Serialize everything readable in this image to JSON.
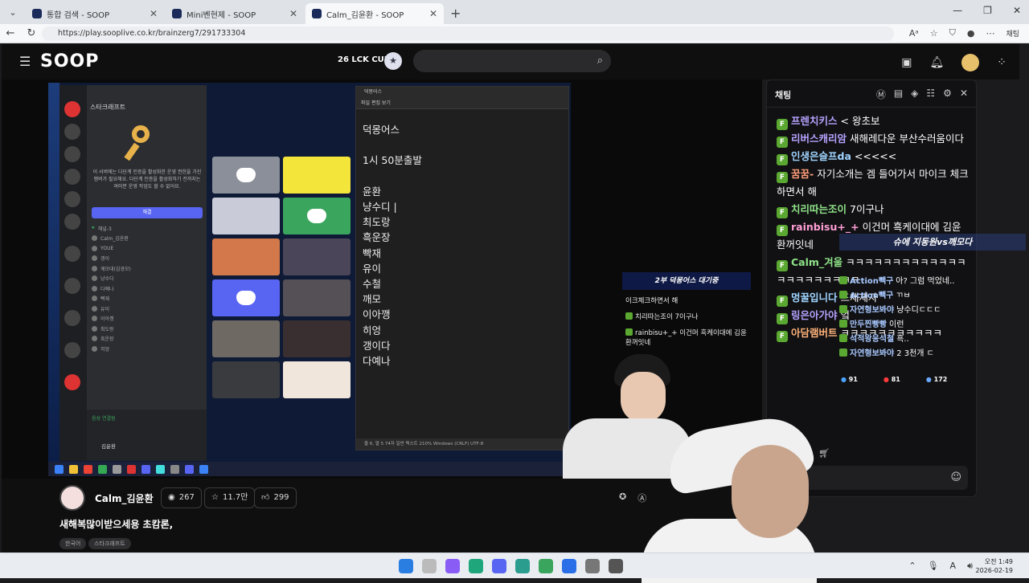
{
  "browser": {
    "tabs": [
      {
        "label": "통합 검색 - SOOP",
        "active": false
      },
      {
        "label": "Mini벤현제 - SOOP",
        "active": false
      },
      {
        "label": "Calm_김윤환 - SOOP",
        "active": true
      }
    ],
    "url": "https://play.sooplive.co.kr/brainzerg7/291733304",
    "chat_button": "채팅"
  },
  "header": {
    "logo": "SOOP",
    "event": "26 LCK CUP"
  },
  "stream": {
    "discord": {
      "server": "스타크래프트",
      "window_title": "스타크래프트",
      "notice": "이 서버에는 다단계 인증을 활성화한 운영 권한을 가진 멤버가 필요해요. 다단계 인증을 활성화하기 전까지는 여러분 운영 작업도 할 수 없어요.",
      "button": "해결",
      "channel": "채널-3",
      "members": [
        "Calm_김윤환",
        "YOUE",
        "갱이",
        "깨모대(김경모)",
        "냥수디",
        "다예나",
        "빡재",
        "유이",
        "이아깽",
        "최도랑",
        "흑운장",
        "히엉"
      ],
      "voice_status": "음성 연결됨",
      "username": "김윤환"
    },
    "notepad": {
      "tab": "덕몽어스",
      "menu": "파일   편집   보기",
      "lines": [
        "덕몽어스",
        "",
        "1시 50분출발",
        "",
        "윤환",
        "냥수디 |",
        "최도랑",
        "흑운장",
        "빡재",
        "유이",
        "수철",
        "깨모",
        "이아깽",
        "히엉",
        "갱이다",
        "다예나"
      ],
      "status": "줄 6, 열 5    74자        일반 텍스트     210%     Windows (CRLF)     UTF-8"
    },
    "overlay_chat": {
      "title": "2부 덕몽어스 대기중",
      "lines": [
        {
          "text": "이크체크하면서 해",
          "badge": false
        },
        {
          "text": "치리따는조이 7이구나",
          "badge": true
        },
        {
          "text": "rainbisu+_+ 이건머 흑케이대에 김윤환꺼잇네",
          "badge": true
        }
      ]
    }
  },
  "channel": {
    "name": "Calm_김윤환",
    "viewers": "267",
    "favorites": "11.7만",
    "likes": "299",
    "title": "새해복많이받으세용 초캄론,",
    "tags": [
      "한국어",
      "스타크래프트"
    ]
  },
  "chat": {
    "label": "채팅",
    "messages": [
      {
        "user": "프렌치키스",
        "text": "< 왕초보",
        "color": "#b7a3ff"
      },
      {
        "user": "리버스캐리암",
        "text": "새해레다운 부산수러움이다",
        "color": "#b7a3ff"
      },
      {
        "user": "인생은슬프da",
        "text": "<<<<<",
        "color": "#9fd4ff"
      },
      {
        "user": "꿈꿈-",
        "text": "자기소개는 겜 들어가서 마이크 체크하면서 해",
        "color": "#ff9e7a"
      },
      {
        "user": "치리따는조이",
        "text": "7이구나",
        "color": "#8fe388"
      },
      {
        "user": "rainbisu+_+",
        "text": "이건머 흑케이대에 김윤환꺼잇네",
        "color": "#ff9ed6"
      },
      {
        "user": "Calm_겨울",
        "text": "ㅋㅋㅋㅋㅋㅋㅋㅋㅋㅋㅋㅋㅋㅋㅋㅋㅋㅋㅋㅋㅋㅋ",
        "color": "#8fe388"
      },
      {
        "user": "멍꿀입니다",
        "text": "드채제자",
        "color": "#9fd4ff"
      },
      {
        "user": "링은아가야",
        "text": "엌",
        "color": "#b7a3ff"
      },
      {
        "user": "아담램버트",
        "text": "ㅋㅋㅋㅋㅋㅋㅋㅋㅋㅋㅋ",
        "color": "#ffb27a"
      }
    ]
  },
  "overlay2": {
    "title": "슈에 지동원vs깨모다",
    "lines": [
      {
        "user": "Action빽구",
        "text": "아? 그럼 먹었네.."
      },
      {
        "user": "Action빽구",
        "text": "ㄲㅂ"
      },
      {
        "user": "자연형보봐야",
        "text": "냥수디ㄷㄷㄷ"
      },
      {
        "user": "만두찐빵빵",
        "text": "이런"
      },
      {
        "user": "석적왕응석철",
        "text": "흑.."
      },
      {
        "user": "자연형보봐야",
        "text": "2 3천개 ㄷ"
      }
    ],
    "stats": [
      "91",
      "81",
      "172"
    ]
  },
  "taskbar": {
    "time": "오전 1:49",
    "date": "2026-02-19"
  }
}
